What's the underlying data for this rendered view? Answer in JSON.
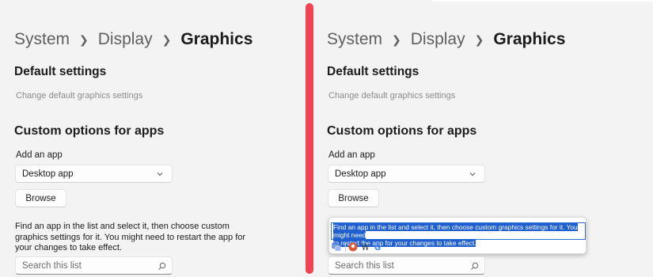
{
  "breadcrumb": [
    "System",
    "Display",
    "Graphics"
  ],
  "default_settings": {
    "heading": "Default settings",
    "link": "Change default graphics settings"
  },
  "custom_options": {
    "heading": "Custom options for apps",
    "add_label": "Add an app",
    "dropdown_value": "Desktop app",
    "browse_label": "Browse",
    "description": "Find an app in the list and select it, then choose custom graphics settings for it. You might need to restart the app for your changes to take effect.",
    "search_placeholder": "Search this list"
  },
  "popup": {
    "selected_line1": "Find an app in the list and select it, then choose custom graphics settings for it. You might need",
    "selected_line2": "to restart the app for your changes to take effect.",
    "extension_icons": [
      "translate-icon",
      "duckduckgo-icon",
      "wikipedia-icon",
      "google-icon"
    ]
  },
  "colors": {
    "divider": "#ef4451",
    "selection": "#1f5fd0",
    "background": "#f3f3f3"
  }
}
